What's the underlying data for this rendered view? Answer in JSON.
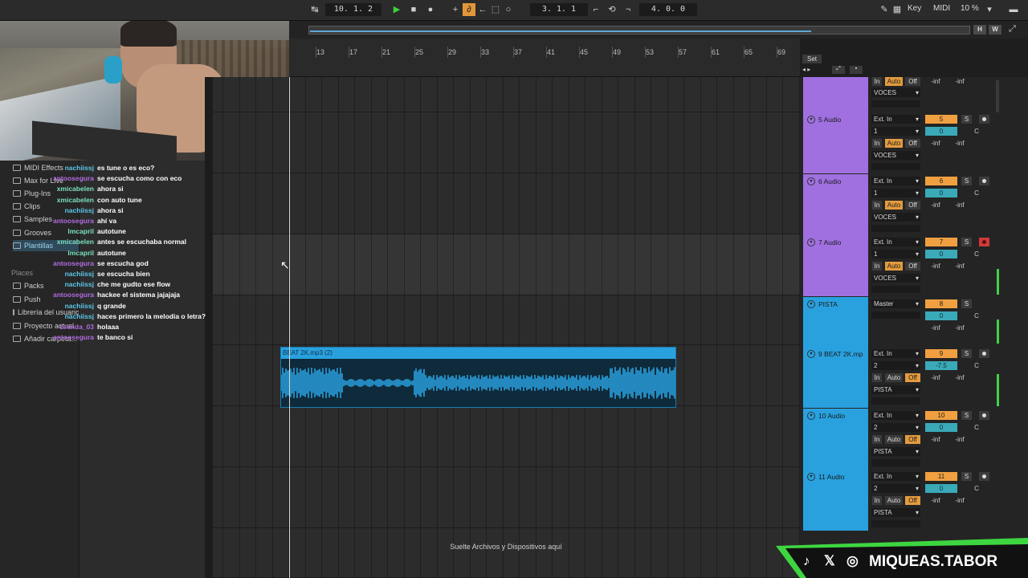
{
  "transport": {
    "position": "10.  1.  2",
    "loop_start": "3.  1.  1",
    "loop_length": "4.  0.  0",
    "key_label": "Key",
    "midi_label": "MIDI",
    "cpu": "10 %",
    "hw_labels": [
      "H",
      "W"
    ]
  },
  "ruler": {
    "bars": [
      "13",
      "17",
      "21",
      "25",
      "29",
      "33",
      "37",
      "41",
      "45",
      "49",
      "53",
      "57",
      "61",
      "65",
      "69"
    ],
    "set_label": "Set"
  },
  "browser": {
    "categories": [
      "MIDI Effects",
      "Max for Live",
      "Plug-Ins",
      "Clips",
      "Samples",
      "Grooves",
      "Plantillas"
    ],
    "places_label": "Places",
    "places": [
      "Packs",
      "Push",
      "Librería del usuario",
      "Proyecto actual",
      "Añadir carpeta..."
    ]
  },
  "chat": [
    {
      "user": "nachiissj",
      "msg": "es tune o es eco?",
      "color": "#5bc8ea"
    },
    {
      "user": "antoosegura",
      "msg": "se escucha como con eco",
      "color": "#b06be0"
    },
    {
      "user": "xmicabelen",
      "msg": "ahora si",
      "color": "#7be0c0"
    },
    {
      "user": "xmicabelen",
      "msg": "con auto tune",
      "color": "#7be0c0"
    },
    {
      "user": "nachiissj",
      "msg": "ahora si",
      "color": "#5bc8ea"
    },
    {
      "user": "antoosegura",
      "msg": "ahí va",
      "color": "#b06be0"
    },
    {
      "user": "lmcapril",
      "msg": "autotune",
      "color": "#7be0c0"
    },
    {
      "user": "xmicabelen",
      "msg": "antes se escuchaba normal",
      "color": "#7be0c0"
    },
    {
      "user": "lmcapril",
      "msg": "autotune",
      "color": "#7be0c0"
    },
    {
      "user": "antoosegura",
      "msg": "se escucha god",
      "color": "#b06be0"
    },
    {
      "user": "nachiissj",
      "msg": "se escucha bien",
      "color": "#5bc8ea"
    },
    {
      "user": "nachiissj",
      "msg": "che me gudto ese flow",
      "color": "#5bc8ea"
    },
    {
      "user": "antoosegura",
      "msg": "hackee el sistema jajajaja",
      "color": "#b06be0"
    },
    {
      "user": "nachiissj",
      "msg": "q grande",
      "color": "#5bc8ea"
    },
    {
      "user": "nachiissj",
      "msg": "haces primero la melodia o letra?",
      "color": "#5bc8ea"
    },
    {
      "user": "brenda_03",
      "msg": "holaaa",
      "color": "#b06be0"
    },
    {
      "user": "antoosegura",
      "msg": "te banco si",
      "color": "#b06be0"
    }
  ],
  "clip": {
    "name": "BEAT 2K.mp3 (2)",
    "color": "#29a1df"
  },
  "drop_text": "Suelte Archivos y Dispositivos aquí",
  "mixer": {
    "top_track": {
      "routing": "VOCES",
      "vol1": "-inf",
      "vol2": "-inf"
    },
    "tracks": [
      {
        "name": "5 Audio",
        "input": "Ext. In",
        "channel": "1",
        "number": "5",
        "send": "0",
        "pan": "C",
        "v1": "-inf",
        "v2": "-inf",
        "out": "VOCES",
        "color": "#a070e0",
        "armed": false
      },
      {
        "name": "6 Audio",
        "input": "Ext. In",
        "channel": "1",
        "number": "6",
        "send": "0",
        "pan": "C",
        "v1": "-inf",
        "v2": "-inf",
        "out": "VOCES",
        "color": "#a070e0",
        "armed": false
      },
      {
        "name": "7 Audio",
        "input": "Ext. In",
        "channel": "1",
        "number": "7",
        "send": "0",
        "pan": "C",
        "v1": "-inf",
        "v2": "-inf",
        "out": "VOCES",
        "color": "#a070e0",
        "armed": true
      },
      {
        "name": "PISTA",
        "input": "Master",
        "channel": "",
        "number": "8",
        "send": "0",
        "pan": "C",
        "v1": "-inf",
        "v2": "-inf",
        "out": "",
        "color": "#29a1df",
        "armed": false
      },
      {
        "name": "9 BEAT 2K.mp",
        "input": "Ext. In",
        "channel": "2",
        "number": "9",
        "send": "-7.5",
        "pan": "C",
        "v1": "-inf",
        "v2": "-inf",
        "out": "PISTA",
        "color": "#29a1df",
        "armed": false
      },
      {
        "name": "10 Audio",
        "input": "Ext. In",
        "channel": "2",
        "number": "10",
        "send": "0",
        "pan": "C",
        "v1": "-inf",
        "v2": "-inf",
        "out": "PISTA",
        "color": "#29a1df",
        "armed": false
      },
      {
        "name": "11 Audio",
        "input": "Ext. In",
        "channel": "2",
        "number": "11",
        "send": "0",
        "pan": "C",
        "v1": "-inf",
        "v2": "-inf",
        "out": "PISTA",
        "color": "#29a1df",
        "armed": false
      }
    ],
    "labels": {
      "in": "In",
      "auto": "Auto",
      "off": "Off",
      "solo": "S"
    }
  },
  "social": {
    "handle": "MIQUEAS.TABOR",
    "icons": [
      "tiktok-icon",
      "x-icon",
      "instagram-icon"
    ]
  }
}
